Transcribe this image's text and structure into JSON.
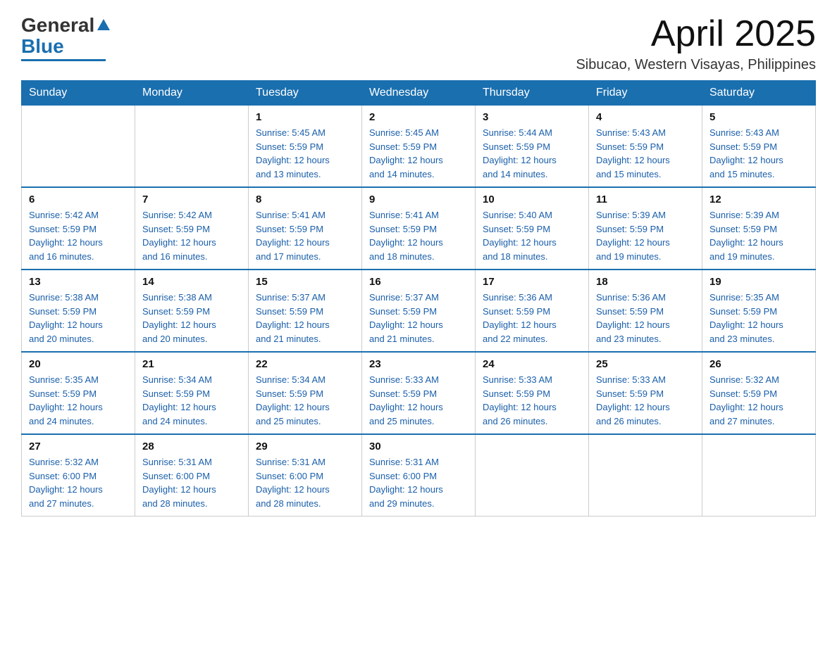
{
  "logo": {
    "general": "General",
    "blue": "Blue"
  },
  "header": {
    "month_year": "April 2025",
    "location": "Sibucao, Western Visayas, Philippines"
  },
  "weekdays": [
    "Sunday",
    "Monday",
    "Tuesday",
    "Wednesday",
    "Thursday",
    "Friday",
    "Saturday"
  ],
  "weeks": [
    [
      {
        "day": "",
        "info": ""
      },
      {
        "day": "",
        "info": ""
      },
      {
        "day": "1",
        "info": "Sunrise: 5:45 AM\nSunset: 5:59 PM\nDaylight: 12 hours\nand 13 minutes."
      },
      {
        "day": "2",
        "info": "Sunrise: 5:45 AM\nSunset: 5:59 PM\nDaylight: 12 hours\nand 14 minutes."
      },
      {
        "day": "3",
        "info": "Sunrise: 5:44 AM\nSunset: 5:59 PM\nDaylight: 12 hours\nand 14 minutes."
      },
      {
        "day": "4",
        "info": "Sunrise: 5:43 AM\nSunset: 5:59 PM\nDaylight: 12 hours\nand 15 minutes."
      },
      {
        "day": "5",
        "info": "Sunrise: 5:43 AM\nSunset: 5:59 PM\nDaylight: 12 hours\nand 15 minutes."
      }
    ],
    [
      {
        "day": "6",
        "info": "Sunrise: 5:42 AM\nSunset: 5:59 PM\nDaylight: 12 hours\nand 16 minutes."
      },
      {
        "day": "7",
        "info": "Sunrise: 5:42 AM\nSunset: 5:59 PM\nDaylight: 12 hours\nand 16 minutes."
      },
      {
        "day": "8",
        "info": "Sunrise: 5:41 AM\nSunset: 5:59 PM\nDaylight: 12 hours\nand 17 minutes."
      },
      {
        "day": "9",
        "info": "Sunrise: 5:41 AM\nSunset: 5:59 PM\nDaylight: 12 hours\nand 18 minutes."
      },
      {
        "day": "10",
        "info": "Sunrise: 5:40 AM\nSunset: 5:59 PM\nDaylight: 12 hours\nand 18 minutes."
      },
      {
        "day": "11",
        "info": "Sunrise: 5:39 AM\nSunset: 5:59 PM\nDaylight: 12 hours\nand 19 minutes."
      },
      {
        "day": "12",
        "info": "Sunrise: 5:39 AM\nSunset: 5:59 PM\nDaylight: 12 hours\nand 19 minutes."
      }
    ],
    [
      {
        "day": "13",
        "info": "Sunrise: 5:38 AM\nSunset: 5:59 PM\nDaylight: 12 hours\nand 20 minutes."
      },
      {
        "day": "14",
        "info": "Sunrise: 5:38 AM\nSunset: 5:59 PM\nDaylight: 12 hours\nand 20 minutes."
      },
      {
        "day": "15",
        "info": "Sunrise: 5:37 AM\nSunset: 5:59 PM\nDaylight: 12 hours\nand 21 minutes."
      },
      {
        "day": "16",
        "info": "Sunrise: 5:37 AM\nSunset: 5:59 PM\nDaylight: 12 hours\nand 21 minutes."
      },
      {
        "day": "17",
        "info": "Sunrise: 5:36 AM\nSunset: 5:59 PM\nDaylight: 12 hours\nand 22 minutes."
      },
      {
        "day": "18",
        "info": "Sunrise: 5:36 AM\nSunset: 5:59 PM\nDaylight: 12 hours\nand 23 minutes."
      },
      {
        "day": "19",
        "info": "Sunrise: 5:35 AM\nSunset: 5:59 PM\nDaylight: 12 hours\nand 23 minutes."
      }
    ],
    [
      {
        "day": "20",
        "info": "Sunrise: 5:35 AM\nSunset: 5:59 PM\nDaylight: 12 hours\nand 24 minutes."
      },
      {
        "day": "21",
        "info": "Sunrise: 5:34 AM\nSunset: 5:59 PM\nDaylight: 12 hours\nand 24 minutes."
      },
      {
        "day": "22",
        "info": "Sunrise: 5:34 AM\nSunset: 5:59 PM\nDaylight: 12 hours\nand 25 minutes."
      },
      {
        "day": "23",
        "info": "Sunrise: 5:33 AM\nSunset: 5:59 PM\nDaylight: 12 hours\nand 25 minutes."
      },
      {
        "day": "24",
        "info": "Sunrise: 5:33 AM\nSunset: 5:59 PM\nDaylight: 12 hours\nand 26 minutes."
      },
      {
        "day": "25",
        "info": "Sunrise: 5:33 AM\nSunset: 5:59 PM\nDaylight: 12 hours\nand 26 minutes."
      },
      {
        "day": "26",
        "info": "Sunrise: 5:32 AM\nSunset: 5:59 PM\nDaylight: 12 hours\nand 27 minutes."
      }
    ],
    [
      {
        "day": "27",
        "info": "Sunrise: 5:32 AM\nSunset: 6:00 PM\nDaylight: 12 hours\nand 27 minutes."
      },
      {
        "day": "28",
        "info": "Sunrise: 5:31 AM\nSunset: 6:00 PM\nDaylight: 12 hours\nand 28 minutes."
      },
      {
        "day": "29",
        "info": "Sunrise: 5:31 AM\nSunset: 6:00 PM\nDaylight: 12 hours\nand 28 minutes."
      },
      {
        "day": "30",
        "info": "Sunrise: 5:31 AM\nSunset: 6:00 PM\nDaylight: 12 hours\nand 29 minutes."
      },
      {
        "day": "",
        "info": ""
      },
      {
        "day": "",
        "info": ""
      },
      {
        "day": "",
        "info": ""
      }
    ]
  ]
}
